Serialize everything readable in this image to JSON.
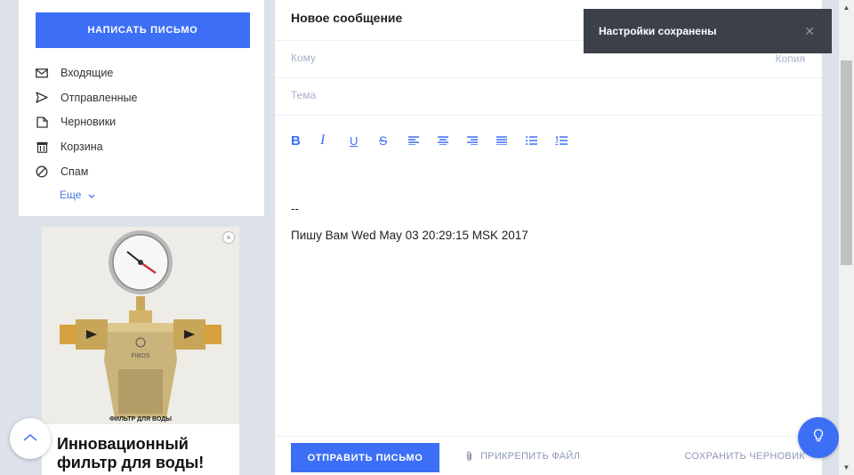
{
  "sidebar": {
    "compose_label": "НАПИСАТЬ ПИСЬМО",
    "folders": [
      {
        "label": "Входящие",
        "icon": "inbox-icon"
      },
      {
        "label": "Отправленные",
        "icon": "send-icon"
      },
      {
        "label": "Черновики",
        "icon": "draft-icon"
      },
      {
        "label": "Корзина",
        "icon": "trash-icon"
      },
      {
        "label": "Спам",
        "icon": "spam-icon"
      }
    ],
    "more_label": "Еще"
  },
  "ad": {
    "title": "Инновационный фильтр для воды!",
    "image_brand": "FIBOS",
    "image_caption": "ФИЛЬТР ДЛЯ ВОДЫ"
  },
  "compose": {
    "title": "Новое сообщение",
    "to_placeholder": "Кому",
    "copy_label": "Копия",
    "subject_placeholder": "Тема",
    "signature_separator": "--",
    "signature_line": "Пишу Вам Wed May 03 20:29:15 MSK 2017",
    "send_label": "ОТПРАВИТЬ ПИСЬМО",
    "attach_label": "ПРИКРЕПИТЬ ФАЙЛ",
    "save_draft_label": "СОХРАНИТЬ ЧЕРНОВИК",
    "toolbar": [
      "bold-icon",
      "italic-icon",
      "underline-icon",
      "strikethrough-icon",
      "align-left-icon",
      "align-center-icon",
      "align-right-icon",
      "align-justify-icon",
      "bulleted-list-icon",
      "numbered-list-icon"
    ]
  },
  "toast": {
    "text": "Настройки сохранены"
  },
  "colors": {
    "accent": "#3d6ff6",
    "background": "#dde1ea",
    "toast": "#3c4049",
    "muted": "#a5b2c6"
  }
}
